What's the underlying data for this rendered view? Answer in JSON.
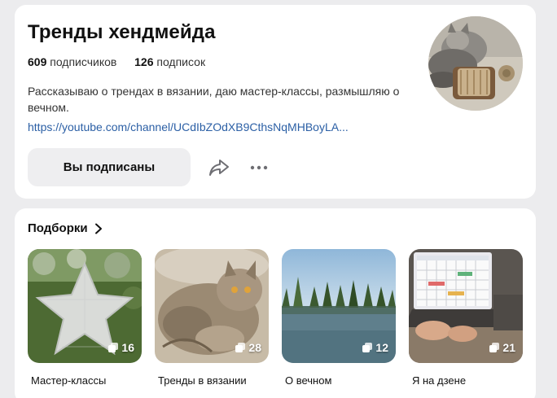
{
  "profile": {
    "title": "Тренды хендмейда",
    "subscribers_count": "609",
    "subscribers_label": "подписчиков",
    "subscriptions_count": "126",
    "subscriptions_label": "подписок",
    "description": "Рассказываю о трендах в вязании, даю мастер-классы, размышляю о вечном.",
    "link": "https://youtube.com/channel/UCdIbZOdXB9CthsNqMHBoyLA...",
    "subscribe_label": "Вы подписаны",
    "share_icon": "share-icon",
    "more_icon": "more-dots-icon",
    "avatar_icon": "cat-with-yarn-avatar"
  },
  "collections": {
    "title": "Подборки",
    "chevron_icon": "chevron-right-icon",
    "items": [
      {
        "label": "Мастер-классы",
        "count": "16"
      },
      {
        "label": "Тренды в вязании",
        "count": "28"
      },
      {
        "label": "О вечном",
        "count": "12"
      },
      {
        "label": "Я на дзене",
        "count": "21"
      }
    ]
  },
  "colors": {
    "page_background": "#ececee",
    "card_background": "#ffffff",
    "link": "#2b5fa5",
    "button_background": "#eeeef0"
  }
}
